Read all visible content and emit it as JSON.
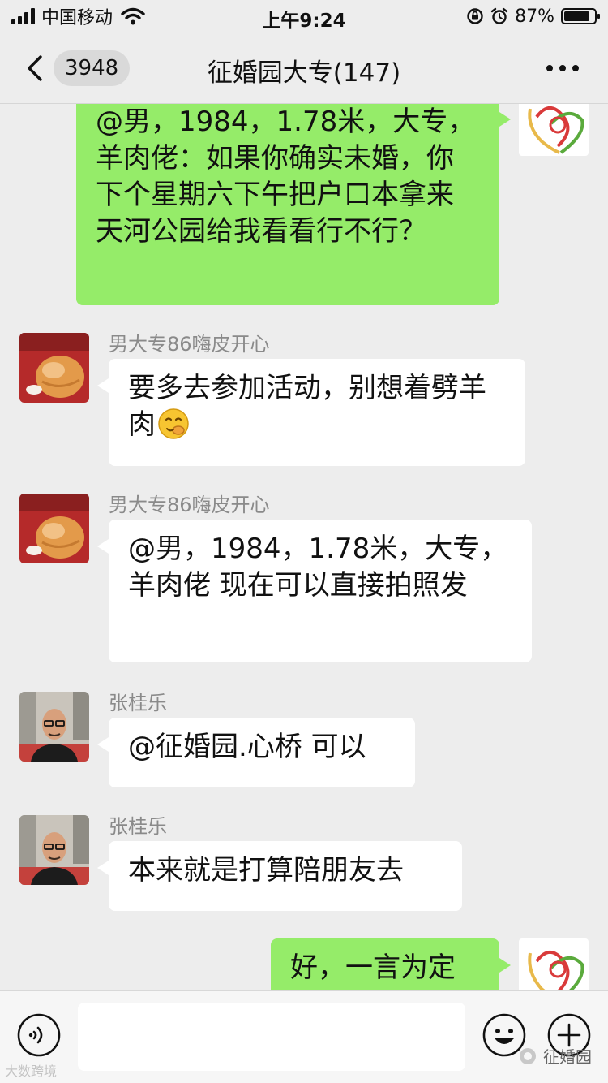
{
  "status_bar": {
    "carrier": "中国移动",
    "time": "上午9:24",
    "battery": "87%",
    "battery_level": 0.87,
    "icons": [
      "signal-icon",
      "wifi-icon",
      "rotation-lock-icon",
      "alarm-icon",
      "battery-icon"
    ]
  },
  "nav": {
    "back_icon": "chevron-left-icon",
    "unread_count": "3948",
    "title": "征婚园大专(147)",
    "more_icon": "more-dots-icon"
  },
  "messages": [
    {
      "direction": "out",
      "avatar": "group-logo-heart-avatar",
      "text": "@男，1984，1.78米，大专，羊肉佬：如果你确实未婚，你下个星期六下午把户口本拿来天河公园给我看看行不行？"
    },
    {
      "direction": "in",
      "sender": "男大专86嗨皮开心",
      "avatar": "orange-cat-avatar",
      "text": "要多去参加活动，别想着劈羊肉",
      "emoji": "shy-face-emoji"
    },
    {
      "direction": "in",
      "sender": "男大专86嗨皮开心",
      "avatar": "orange-cat-avatar",
      "text": "@男，1984，1.78米，大专，羊肉佬 现在可以直接拍照发"
    },
    {
      "direction": "in",
      "sender": "张桂乐",
      "avatar": "man-glasses-photo-avatar",
      "text": "@征婚园.心桥 可以"
    },
    {
      "direction": "in",
      "sender": "张桂乐",
      "avatar": "man-glasses-photo-avatar",
      "text": "本来就是打算陪朋友去"
    },
    {
      "direction": "out",
      "avatar": "group-logo-heart-avatar",
      "text": "好，一言为定"
    }
  ],
  "input_bar": {
    "voice_icon": "voice-icon",
    "text_value": "",
    "emoji_icon": "emoji-smile-icon",
    "plus_icon": "plus-circle-icon"
  },
  "watermarks": {
    "left": "大数跨境",
    "right": "征婚园"
  },
  "colors": {
    "background": "#ededed",
    "outgoing_bubble": "#95ec69",
    "incoming_bubble": "#ffffff",
    "sender_name": "#8a8a8a"
  }
}
